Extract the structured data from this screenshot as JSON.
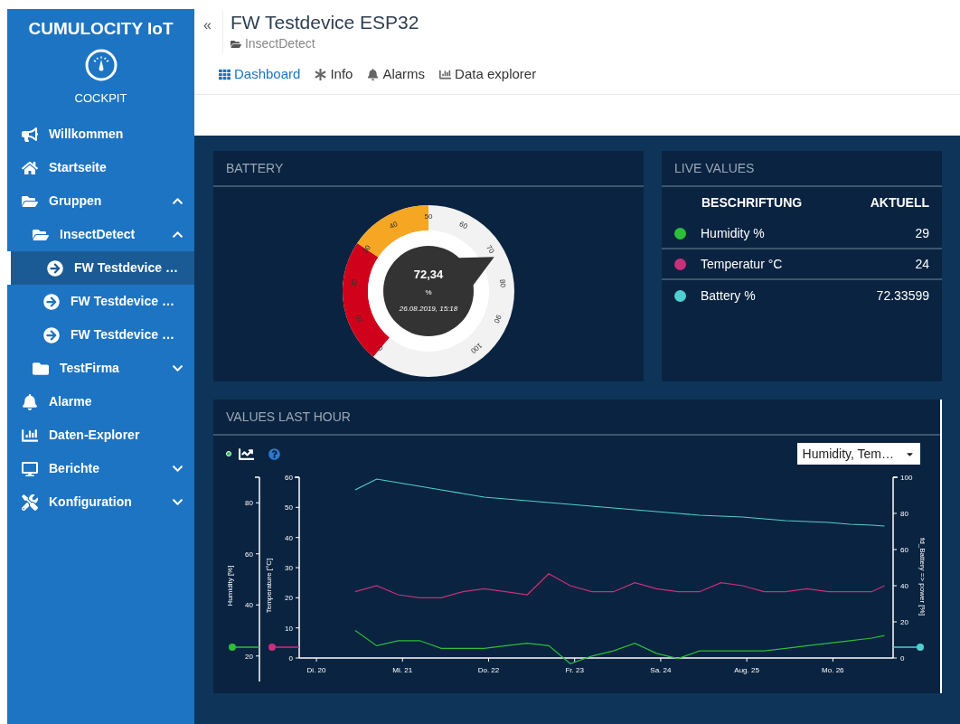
{
  "sidebar": {
    "brand": "CUMULOCITY IoT",
    "app": "COCKPIT",
    "items": [
      {
        "label": "Willkommen",
        "kind": "megaphone"
      },
      {
        "label": "Startseite",
        "kind": "home"
      },
      {
        "label": "Gruppen",
        "kind": "folder-open",
        "expanded": true,
        "children": [
          {
            "label": "InsectDetect",
            "kind": "folder-open",
            "expanded": true,
            "children": [
              {
                "label": "FW Testdevice …",
                "kind": "device",
                "selected": true
              },
              {
                "label": "FW Testdevice …",
                "kind": "device",
                "selected": false
              },
              {
                "label": "FW Testdevice …",
                "kind": "device",
                "selected": false
              }
            ]
          },
          {
            "label": "TestFirma",
            "kind": "folder",
            "expanded": false
          }
        ]
      },
      {
        "label": "Alarme",
        "kind": "bell"
      },
      {
        "label": "Daten-Explorer",
        "kind": "chart"
      },
      {
        "label": "Berichte",
        "kind": "report",
        "expanded": false
      },
      {
        "label": "Konfiguration",
        "kind": "tools",
        "expanded": false
      }
    ]
  },
  "header": {
    "collapse": "«",
    "title": "FW Testdevice ESP32",
    "breadcrumb": "InsectDetect",
    "tabs": [
      {
        "label": "Dashboard",
        "kind": "grid",
        "selected": true
      },
      {
        "label": "Info",
        "kind": "asterisk",
        "selected": false
      },
      {
        "label": "Alarms",
        "kind": "bell",
        "selected": false
      },
      {
        "label": "Data explorer",
        "kind": "chart",
        "selected": false
      }
    ]
  },
  "battery": {
    "title": "BATTERY",
    "value": "72,34",
    "unit": "%",
    "time": "26.08.2019, 15:18",
    "ticks": [
      "0",
      "10",
      "20",
      "30",
      "40",
      "50",
      "60",
      "70",
      "80",
      "90",
      "100"
    ]
  },
  "live_values": {
    "title": "LIVE VALUES",
    "columns": [
      "BESCHRIFTUNG",
      "AKTUELL"
    ],
    "rows": [
      {
        "color": "#2dbd3a",
        "label": "Humidity %",
        "value": "29"
      },
      {
        "color": "#c8307a",
        "label": "Temperatur °C",
        "value": "24"
      },
      {
        "color": "#4fcfcf",
        "label": "Battery %",
        "value": "72.33599"
      }
    ]
  },
  "values_last_hour": {
    "title": "VALUES LAST HOUR",
    "series_select": "Humidity, Tem…",
    "chart_data": {
      "type": "line",
      "xlim": [
        19.8,
        26.7
      ],
      "xticks": [
        {
          "value": 20,
          "label": "Di. 20"
        },
        {
          "value": 21,
          "label": "Mi. 21"
        },
        {
          "value": 22,
          "label": "Do. 22"
        },
        {
          "value": 23,
          "label": "Fr. 23"
        },
        {
          "value": 24,
          "label": "Sa. 24"
        },
        {
          "value": 25,
          "label": "Aug. 25"
        },
        {
          "value": 26,
          "label": "Mo. 26"
        }
      ],
      "x": [
        20.45,
        20.7,
        20.95,
        21.2,
        21.45,
        21.7,
        21.95,
        22.2,
        22.45,
        22.7,
        22.95,
        23.2,
        23.45,
        23.7,
        23.95,
        24.2,
        24.45,
        24.7,
        24.95,
        25.2,
        25.45,
        25.7,
        25.95,
        26.2,
        26.45,
        26.6
      ],
      "ylabel": "Temperature [°C]",
      "ylim": [
        0,
        60
      ],
      "yticks": [
        0,
        10,
        20,
        30,
        40,
        50,
        60
      ],
      "y2label": "fd_Battery => power [%]",
      "y2lim": [
        0,
        100
      ],
      "y2ticks": [
        0,
        20,
        40,
        60,
        80,
        100
      ],
      "y3label": "Humidity [%]",
      "y3lim": [
        10,
        90
      ],
      "y3ticks": [
        20,
        40,
        60,
        80
      ],
      "series": [
        {
          "color": "#2dbd3a",
          "axis": "y3",
          "values": [
            30,
            24,
            26,
            26,
            23,
            23,
            23,
            24,
            25,
            24,
            17,
            20,
            22,
            25,
            21,
            19,
            22,
            22,
            22,
            22,
            23,
            24,
            25,
            26,
            27,
            28
          ]
        },
        {
          "color": "#c8307a",
          "values": [
            22,
            24,
            21,
            20,
            20,
            22,
            23,
            22,
            21,
            28,
            24,
            22,
            22,
            25,
            23,
            22,
            22,
            25,
            24,
            22,
            22,
            23,
            22,
            22,
            22,
            24
          ]
        },
        {
          "color": "#4fcfcf",
          "axis": "y2",
          "values": [
            93,
            99,
            97,
            95,
            93,
            91,
            89,
            88,
            87,
            86,
            85,
            84,
            83,
            82,
            81,
            80,
            79,
            78.5,
            78,
            77,
            76,
            75.5,
            75,
            74,
            73.5,
            73
          ]
        }
      ]
    }
  }
}
